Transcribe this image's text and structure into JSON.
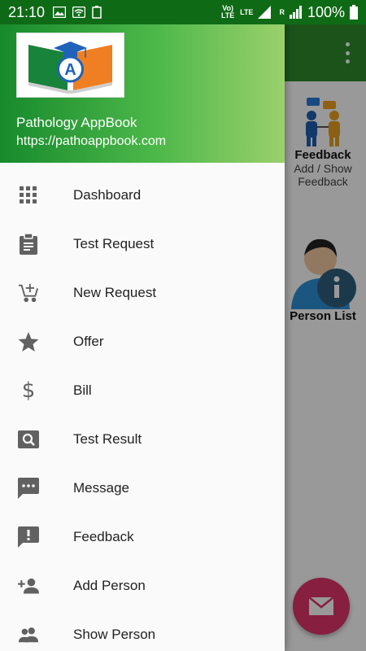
{
  "status_bar": {
    "time": "21:10",
    "net1": "Vo) LTE",
    "net2": "LTE",
    "signal_label": "R",
    "battery": "100%"
  },
  "drawer": {
    "app_name": "Pathology AppBook",
    "app_url": "https://pathoappbook.com",
    "logo_letter": "A",
    "items": [
      {
        "label": "Dashboard",
        "icon": "grid-icon"
      },
      {
        "label": "Test Request",
        "icon": "clipboard-icon"
      },
      {
        "label": "New Request",
        "icon": "add-cart-icon"
      },
      {
        "label": "Offer",
        "icon": "star-icon"
      },
      {
        "label": "Bill",
        "icon": "dollar-icon"
      },
      {
        "label": "Test Result",
        "icon": "search-result-icon"
      },
      {
        "label": "Message",
        "icon": "message-icon"
      },
      {
        "label": "Feedback",
        "icon": "feedback-icon"
      },
      {
        "label": "Add Person",
        "icon": "add-person-icon"
      },
      {
        "label": "Show Person",
        "icon": "people-icon"
      }
    ]
  },
  "background": {
    "feedback_title": "Feedback",
    "feedback_sub1": "Add / Show",
    "feedback_sub2": "Feedback",
    "person_list": "Person List"
  },
  "colors": {
    "status_bar": "#0f6a16",
    "toolbar": "#2e8b2e",
    "fab": "#e0356b",
    "icon": "#616161"
  }
}
